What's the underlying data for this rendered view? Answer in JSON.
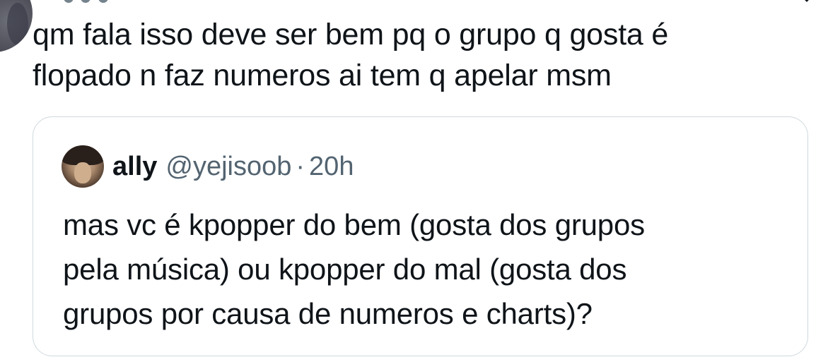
{
  "reply": {
    "avatar_icon": "user-avatar-icon",
    "text_line1": "qm fala isso deve ser bem pq o grupo q gosta é",
    "text_line2": "flopado n faz numeros ai tem q apelar msm"
  },
  "quote": {
    "avatar_icon": "user-avatar-icon",
    "name": "ally",
    "handle": "@yejisoob",
    "separator": "·",
    "time": "20h",
    "text_line1": "mas vc é kpopper do bem (gosta dos grupos",
    "text_line2": "pela música) ou kpopper do mal (gosta dos",
    "text_line3": "grupos por causa de numeros e charts)?"
  },
  "icons": {
    "more": "more-options-icon"
  },
  "colors": {
    "text_primary": "#0f1419",
    "text_secondary": "#536471",
    "card_border": "#cfd9de",
    "background": "#ffffff"
  }
}
